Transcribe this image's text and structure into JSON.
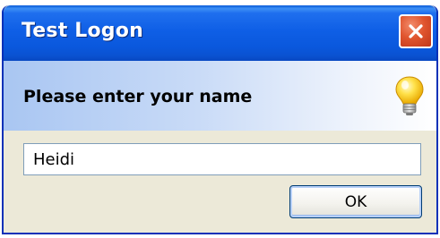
{
  "window": {
    "title": "Test Logon",
    "close_icon": "close-icon"
  },
  "header": {
    "prompt": "Please enter your name",
    "icon": "lightbulb-icon"
  },
  "form": {
    "name_value": "Heidi"
  },
  "buttons": {
    "ok_label": "OK"
  },
  "colors": {
    "titlebar": "#0a58dd",
    "window_face": "#ece9d8",
    "close_button": "#e0552e",
    "input_border": "#7f9db9",
    "button_border": "#003c74"
  }
}
